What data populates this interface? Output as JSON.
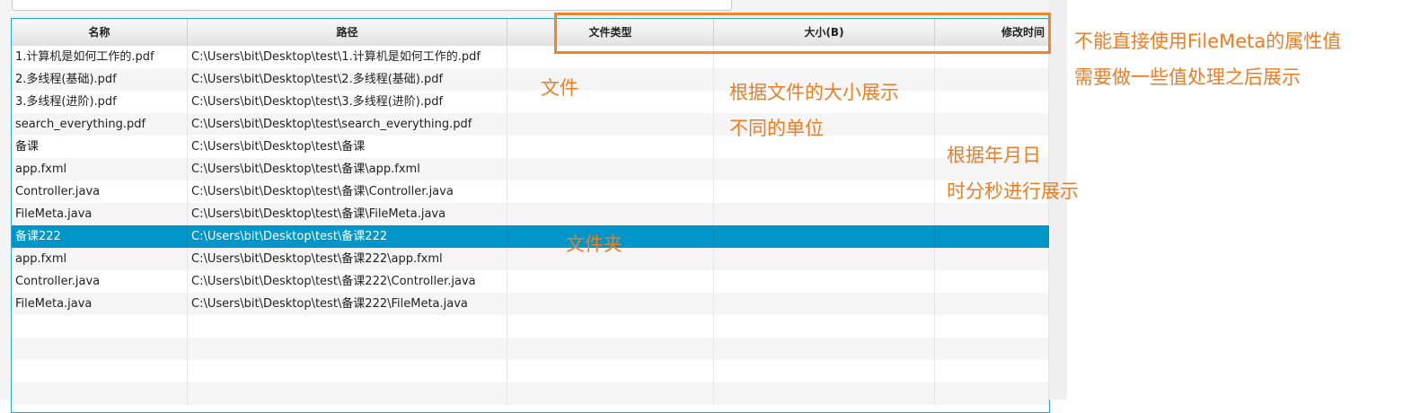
{
  "table": {
    "columns": [
      "名称",
      "路径",
      "文件类型",
      "大小(B)",
      "修改时间"
    ],
    "rows": [
      [
        "1.计算机是如何工作的.pdf",
        "C:\\Users\\bit\\Desktop\\test\\1.计算机是如何工作的.pdf",
        "",
        "",
        ""
      ],
      [
        "2.多线程(基础).pdf",
        "C:\\Users\\bit\\Desktop\\test\\2.多线程(基础).pdf",
        "",
        "",
        ""
      ],
      [
        "3.多线程(进阶).pdf",
        "C:\\Users\\bit\\Desktop\\test\\3.多线程(进阶).pdf",
        "",
        "",
        ""
      ],
      [
        "search_everything.pdf",
        "C:\\Users\\bit\\Desktop\\test\\search_everything.pdf",
        "",
        "",
        ""
      ],
      [
        "备课",
        "C:\\Users\\bit\\Desktop\\test\\备课",
        "",
        "",
        ""
      ],
      [
        "app.fxml",
        "C:\\Users\\bit\\Desktop\\test\\备课\\app.fxml",
        "",
        "",
        ""
      ],
      [
        "Controller.java",
        "C:\\Users\\bit\\Desktop\\test\\备课\\Controller.java",
        "",
        "",
        ""
      ],
      [
        "FileMeta.java",
        "C:\\Users\\bit\\Desktop\\test\\备课\\FileMeta.java",
        "",
        "",
        ""
      ],
      [
        "备课222",
        "C:\\Users\\bit\\Desktop\\test\\备课222",
        "",
        "",
        ""
      ],
      [
        "app.fxml",
        "C:\\Users\\bit\\Desktop\\test\\备课222\\app.fxml",
        "",
        "",
        ""
      ],
      [
        "Controller.java",
        "C:\\Users\\bit\\Desktop\\test\\备课222\\Controller.java",
        "",
        "",
        ""
      ],
      [
        "FileMeta.java",
        "C:\\Users\\bit\\Desktop\\test\\备课222\\FileMeta.java",
        "",
        "",
        ""
      ],
      [
        "",
        "",
        "",
        "",
        ""
      ],
      [
        "",
        "",
        "",
        "",
        ""
      ],
      [
        "",
        "",
        "",
        "",
        ""
      ],
      [
        "",
        "",
        "",
        "",
        ""
      ]
    ],
    "selected_row": 8
  },
  "annotations": {
    "file_label": "文件",
    "folder_label": "文件夹",
    "size_note_line1": "根据文件的大小展示",
    "size_note_line2": "不同的单位",
    "time_note_line1": "根据年月日",
    "time_note_line2": "时分秒进行展示",
    "header_note_line1": "不能直接使用FileMeta的属性值",
    "header_note_line2": "需要做一些值处理之后展示"
  },
  "colors": {
    "selection": "#0096c9",
    "table_border": "#2ba6d6",
    "annotation": "#f07c22"
  }
}
